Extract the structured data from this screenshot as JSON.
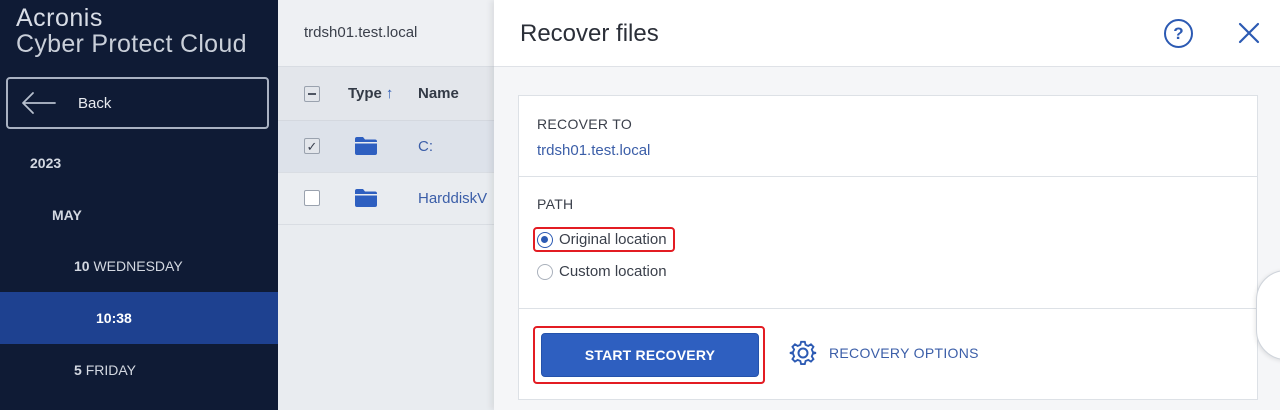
{
  "sidebar": {
    "brand_line1": "Acronis",
    "brand_line2": "Cyber Protect Cloud",
    "back_label": "Back",
    "year": "2023",
    "month": "MAY",
    "day1_num": "10",
    "day1_name": "WEDNESDAY",
    "time": "10:38",
    "day2_num": "5",
    "day2_name": "FRIDAY"
  },
  "main": {
    "server": "trdsh01.test.local",
    "columns": {
      "type": "Type",
      "name": "Name"
    },
    "rows": [
      {
        "name": "C:",
        "checked": true
      },
      {
        "name": "HarddiskV",
        "checked": false
      }
    ]
  },
  "modal": {
    "title": "Recover files",
    "help_label": "?",
    "recover_to_label": "RECOVER TO",
    "recover_to_value": "trdsh01.test.local",
    "path_label": "PATH",
    "options": [
      {
        "label": "Original location",
        "selected": true
      },
      {
        "label": "Custom location",
        "selected": false
      }
    ],
    "start_label": "START RECOVERY",
    "recovery_options_label": "RECOVERY OPTIONS"
  },
  "colors": {
    "sidebar_bg": "#0f1b35",
    "selected_nav": "#1e4190",
    "accent": "#2e5fc0",
    "highlight_border": "#e31c23",
    "link": "#3b5ea8"
  },
  "icons": [
    "back-arrow-icon",
    "sort-up-icon",
    "folder-icon",
    "help-icon",
    "close-icon",
    "gear-icon",
    "check-icon"
  ]
}
